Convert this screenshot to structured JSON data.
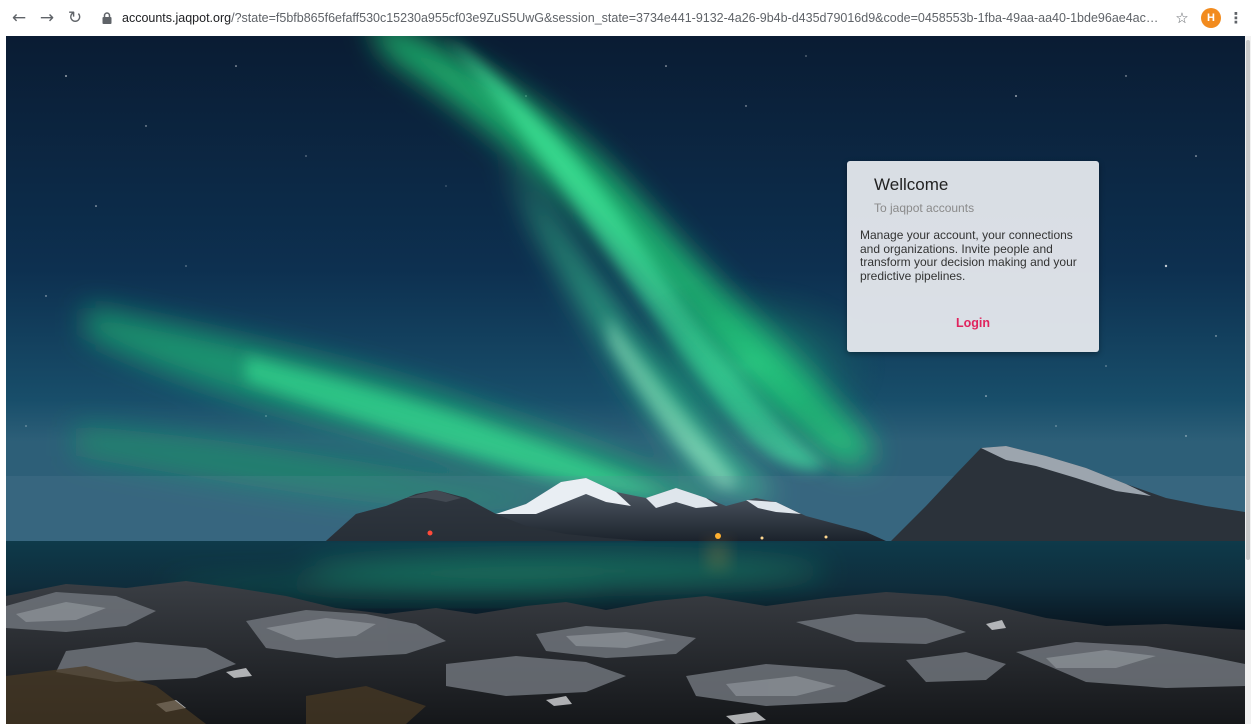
{
  "browser": {
    "url_host": "accounts.jaqpot.org",
    "url_rest": "/?state=f5bfb865f6efaff530c15230a955cf03e9ZuS5UwG&session_state=3734e441-9132-4a26-9b4b-d435d79016d9&code=0458553b-1fba-49aa-aa40-1bde96ae4ac5.3734...",
    "profile_initial": "H",
    "icons": {
      "back": "arrow-left-icon",
      "forward": "arrow-right-icon",
      "reload": "reload-icon",
      "lock": "lock-icon",
      "bookmark": "star-icon",
      "menu": "kebab-menu-icon"
    }
  },
  "card": {
    "title": "Wellcome",
    "subtitle": "To jaqpot accounts",
    "body": "Manage your account, your connections and organizations. Invite people and transform your decision making and your predictive pipelines.",
    "action_label": "Login"
  },
  "colors": {
    "accent": "#e0245e",
    "avatar": "#f28b1e"
  }
}
